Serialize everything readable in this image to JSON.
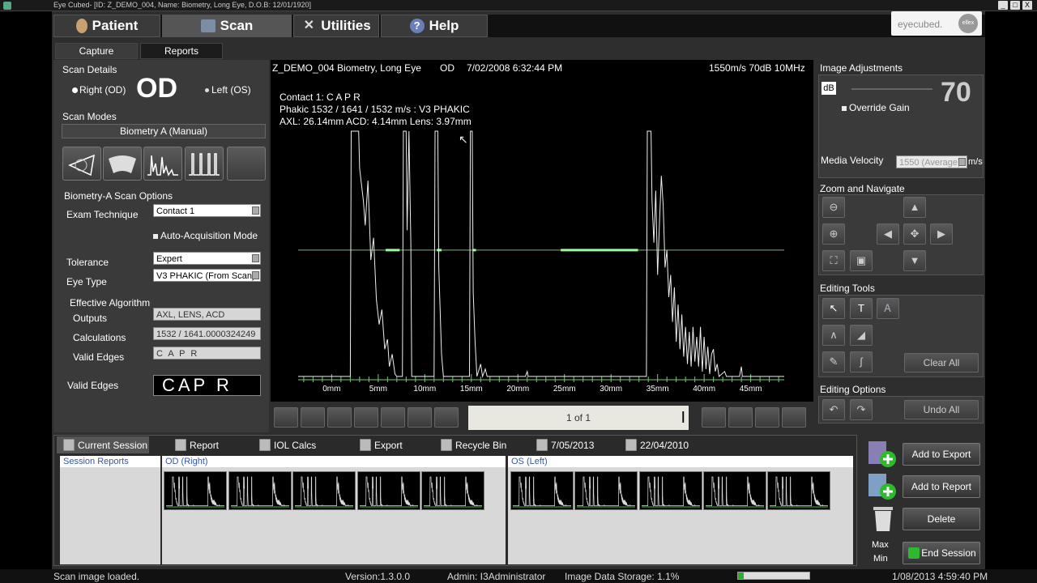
{
  "window": {
    "title": "Eye Cubed- [ID: Z_DEMO_004, Name: Biometry, Long Eye, D.O.B: 12/01/1920]",
    "controls": [
      "_",
      "□",
      "X"
    ]
  },
  "main_tabs": [
    {
      "label": "Patient",
      "icon": "patient-icon"
    },
    {
      "label": "Scan",
      "icon": "scan-icon"
    },
    {
      "label": "Utilities",
      "icon": "tools-icon"
    },
    {
      "label": "Help",
      "icon": "help-icon"
    }
  ],
  "logo": {
    "text": "eyecubed.",
    "badge": "ellex"
  },
  "sub_tabs": [
    "Capture",
    "Reports"
  ],
  "scan_details": {
    "title": "Scan Details",
    "right_label": "Right (OD)",
    "eye_value": "OD",
    "left_label": "Left (OS)",
    "selected": "right"
  },
  "scan_modes": {
    "title": "Scan Modes",
    "current": "Biometry A (Manual)",
    "icons": [
      "b-scan-icon",
      "b-scan-wide-icon",
      "a-scan-icon",
      "biometry-icon",
      "blank-mode-icon"
    ]
  },
  "options": {
    "title": "Biometry-A Scan Options",
    "exam_technique_label": "Exam Technique",
    "exam_technique": "Contact 1",
    "auto_acq_label": "Auto-Acquisition Mode",
    "tolerance_label": "Tolerance",
    "tolerance": "Expert",
    "eye_type_label": "Eye Type",
    "eye_type": "V3 PHAKIC (From Scan)",
    "effective_label": "Effective Algorithm",
    "outputs_label": "Outputs",
    "outputs": "AXL, LENS, ACD",
    "calculations_label": "Calculations",
    "calculations": "1532 / 1641.0000324249",
    "valid_edges_label": "Valid Edges",
    "valid_edges": "C A P R",
    "valid_edges_big_label": "Valid Edges",
    "valid_edges_big": "CAP R"
  },
  "scan": {
    "header_left": "Z_DEMO_004 Biometry, Long Eye",
    "header_eye": "OD",
    "header_date": "7/02/2008 6:32:44 PM",
    "header_right": "1550m/s  70dB 10MHz",
    "info1": "Contact 1: C A P   R",
    "info2": "Phakic 1532 / 1641 / 1532 m/s : V3 PHAKIC",
    "info3": "AXL: 26.14mm   ACD: 4.14mm   Lens: 3.97mm",
    "ticks": [
      "0mm",
      "5mm",
      "10mm",
      "15mm",
      "20mm",
      "25mm",
      "30mm",
      "35mm",
      "40mm",
      "45mm"
    ]
  },
  "chart_data": {
    "type": "line",
    "title": "",
    "xlabel": "",
    "ylabel": "",
    "x_unit": "mm",
    "xlim": [
      -3.6,
      48.6
    ],
    "ylim": [
      0,
      1
    ],
    "x_ticks": [
      0,
      5,
      10,
      15,
      20,
      25,
      30,
      35,
      40,
      45
    ],
    "grid": false,
    "gate_line": {
      "y": 0.52
    },
    "gate_segments_mm": [
      [
        5.8,
        7.3
      ],
      [
        11.3,
        11.8
      ],
      [
        15.2,
        15.5
      ],
      [
        24.6,
        32.9
      ]
    ],
    "series": [
      {
        "values": [
          [
            -3.6,
            0.01
          ],
          [
            2.0,
            0.01
          ],
          [
            2.1,
            1.0
          ],
          [
            2.9,
            1.0
          ],
          [
            3.0,
            0.85
          ],
          [
            3.4,
            0.72
          ],
          [
            3.6,
            0.62
          ],
          [
            3.9,
            0.8
          ],
          [
            4.2,
            0.48
          ],
          [
            4.5,
            0.57
          ],
          [
            4.8,
            0.32
          ],
          [
            5.1,
            0.22
          ],
          [
            5.4,
            0.28
          ],
          [
            5.7,
            0.12
          ],
          [
            6.0,
            0.16
          ],
          [
            6.2,
            0.05
          ],
          [
            6.5,
            0.1
          ],
          [
            6.8,
            0.02
          ],
          [
            7.0,
            0.01
          ],
          [
            7.6,
            0.01
          ],
          [
            7.7,
            1.0
          ],
          [
            8.0,
            1.0
          ],
          [
            8.1,
            0.6
          ],
          [
            8.3,
            1.0
          ],
          [
            8.5,
            0.55
          ],
          [
            8.6,
            0.01
          ],
          [
            11.0,
            0.01
          ],
          [
            11.1,
            1.0
          ],
          [
            11.4,
            1.0
          ],
          [
            11.5,
            0.45
          ],
          [
            11.8,
            0.1
          ],
          [
            12.0,
            0.01
          ],
          [
            14.8,
            0.01
          ],
          [
            14.9,
            1.0
          ],
          [
            15.1,
            1.0
          ],
          [
            15.2,
            0.35
          ],
          [
            15.4,
            0.15
          ],
          [
            15.6,
            0.01
          ],
          [
            16.0,
            0.06
          ],
          [
            16.2,
            0.01
          ],
          [
            16.5,
            0.04
          ],
          [
            16.7,
            0.01
          ],
          [
            20.8,
            0.01
          ],
          [
            21.0,
            0.03
          ],
          [
            21.1,
            0.01
          ],
          [
            33.8,
            0.01
          ],
          [
            33.9,
            1.0
          ],
          [
            34.3,
            1.0
          ],
          [
            34.4,
            0.72
          ],
          [
            34.6,
            0.55
          ],
          [
            34.8,
            0.76
          ],
          [
            35.0,
            0.42
          ],
          [
            35.2,
            0.63
          ],
          [
            35.4,
            0.82
          ],
          [
            35.6,
            0.7
          ],
          [
            35.8,
            0.45
          ],
          [
            36.0,
            0.52
          ],
          [
            36.2,
            0.33
          ],
          [
            36.4,
            0.42
          ],
          [
            36.6,
            0.23
          ],
          [
            36.8,
            0.37
          ],
          [
            37.0,
            0.15
          ],
          [
            37.2,
            0.3
          ],
          [
            37.4,
            0.12
          ],
          [
            37.6,
            0.26
          ],
          [
            37.8,
            0.09
          ],
          [
            38.0,
            0.21
          ],
          [
            38.2,
            0.06
          ],
          [
            38.4,
            0.19
          ],
          [
            38.6,
            0.05
          ],
          [
            38.8,
            0.21
          ],
          [
            39.0,
            0.07
          ],
          [
            39.2,
            0.17
          ],
          [
            39.4,
            0.05
          ],
          [
            39.6,
            0.21
          ],
          [
            39.8,
            0.03
          ],
          [
            40.0,
            0.17
          ],
          [
            40.2,
            0.04
          ],
          [
            40.4,
            0.13
          ],
          [
            40.6,
            0.02
          ],
          [
            40.8,
            0.1
          ],
          [
            41.0,
            0.12
          ],
          [
            41.2,
            0.03
          ],
          [
            41.4,
            0.06
          ],
          [
            41.6,
            0.01
          ],
          [
            42.2,
            0.03
          ],
          [
            42.4,
            0.01
          ],
          [
            43.8,
            0.01
          ],
          [
            44.0,
            0.05
          ],
          [
            44.1,
            0.01
          ],
          [
            48.6,
            0.01
          ]
        ]
      }
    ]
  },
  "pager": {
    "text": "1 of 1"
  },
  "image_adjustments": {
    "title": "Image Adjustments",
    "db_label": "dB",
    "gain": "70",
    "override_label": "Override Gain",
    "media_velocity_label": "Media Velocity",
    "media_velocity": "1550 (Average)",
    "velocity_unit": "m/s"
  },
  "zoom": {
    "title": "Zoom and Navigate"
  },
  "editing_tools": {
    "title": "Editing Tools",
    "text_tool": "T",
    "clear_label": "Clear All"
  },
  "editing_options": {
    "title": "Editing Options",
    "undo_label": "Undo All"
  },
  "bottom_tabs": [
    "Current Session",
    "Report",
    "IOL Calcs",
    "Export",
    "Recycle Bin",
    "7/05/2013",
    "22/04/2010"
  ],
  "columns": {
    "session": "Session Reports",
    "od": "OD (Right)",
    "os": "OS (Left)"
  },
  "actions": {
    "add_export": "Add to Export",
    "add_report": "Add to Report",
    "delete": "Delete",
    "max": "Max",
    "min": "Min",
    "end": "End Session"
  },
  "status": {
    "message": "Scan image loaded.",
    "version": "Version:1.3.0.0",
    "admin": "Admin: I3Administrator",
    "storage": "Image Data Storage: 1.1%",
    "storage_fraction": 0.08,
    "datetime": "1/08/2013 4:59:40 PM"
  }
}
